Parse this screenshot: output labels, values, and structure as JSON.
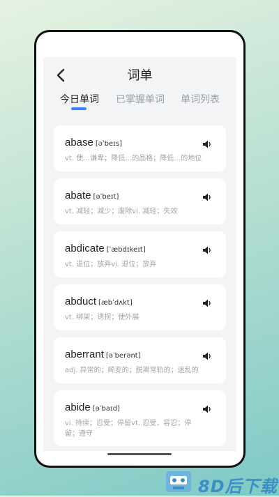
{
  "header": {
    "title": "词单"
  },
  "tabs": [
    {
      "label": "今日单词",
      "active": true
    },
    {
      "label": "已掌握单词",
      "active": false
    },
    {
      "label": "单词列表",
      "active": false
    }
  ],
  "words": [
    {
      "word": "abase",
      "phonetic": "[əˈbeɪs]",
      "meaning": "vt. 使…谦卑；降低…的品格；降低…的地位"
    },
    {
      "word": "abate",
      "phonetic": "[əˈbeɪt]",
      "meaning": "vt. 减轻；减少；废除vi. 减轻；失效"
    },
    {
      "word": "abdicate",
      "phonetic": "[ˈæbdɪkeɪt]",
      "meaning": "vt. 退位；放弃vi. 退位；放弃"
    },
    {
      "word": "abduct",
      "phonetic": "[æbˈdʌkt]",
      "meaning": "vt. 绑架；诱拐；使外展"
    },
    {
      "word": "aberrant",
      "phonetic": "[əˈberənt]",
      "meaning": "adj. 异常的；畸变的；脱离常轨的；迷乱的"
    },
    {
      "word": "abide",
      "phonetic": "[əˈbaɪd]",
      "meaning": "vi. 持续；忍受；停留vt. 忍受，容忍；停留；遵守"
    }
  ],
  "watermark": {
    "text": "8D后下载"
  },
  "colors": {
    "accent": "#3b82f6",
    "watermark": "#3a8fc7"
  }
}
